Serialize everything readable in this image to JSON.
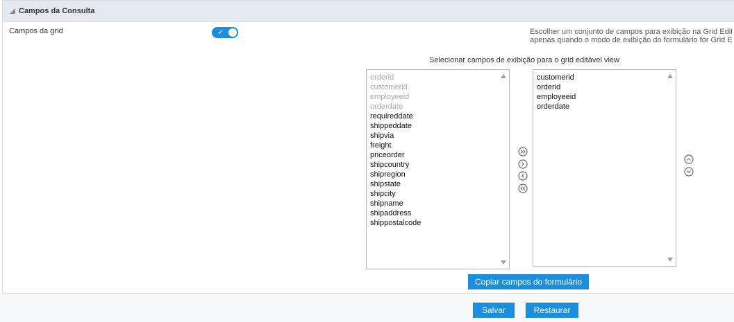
{
  "panel": {
    "title": "Campos da Consulta"
  },
  "field": {
    "label": "Campos da grid",
    "toggle_on": true,
    "help_line1": "Escolher um conjunto de campos para exibição na Grid Editá",
    "help_line2": "apenas quando o modo de exibição do formulário for Grid Ed"
  },
  "selector": {
    "title": "Selecionar campos de exibição para o grid editável view",
    "available": [
      {
        "label": "orderid",
        "disabled": true
      },
      {
        "label": "customerid",
        "disabled": true
      },
      {
        "label": "employeeid",
        "disabled": true
      },
      {
        "label": "orderdate",
        "disabled": true
      },
      {
        "label": "requireddate",
        "disabled": false
      },
      {
        "label": "shippeddate",
        "disabled": false
      },
      {
        "label": "shipvia",
        "disabled": false
      },
      {
        "label": "freight",
        "disabled": false
      },
      {
        "label": "priceorder",
        "disabled": false
      },
      {
        "label": "shipcountry",
        "disabled": false
      },
      {
        "label": "shipregion",
        "disabled": false
      },
      {
        "label": "shipstate",
        "disabled": false
      },
      {
        "label": "shipcity",
        "disabled": false
      },
      {
        "label": "shipname",
        "disabled": false
      },
      {
        "label": "shipaddress",
        "disabled": false
      },
      {
        "label": "shippostalcode",
        "disabled": false
      }
    ],
    "selected": [
      "customerid",
      "orderid",
      "employeeid",
      "orderdate"
    ]
  },
  "buttons": {
    "copy": "Copiar campos do formulário",
    "save": "Salvar",
    "restore": "Restaurar"
  },
  "colors": {
    "accent": "#1a8fdd",
    "header_bg": "#e4e9ef"
  },
  "icons": {
    "collapse": "triangle-collapse-icon",
    "move_all_right": "double-chevron-right-circle-icon",
    "move_right": "chevron-right-circle-icon",
    "move_left": "chevron-left-circle-icon",
    "move_all_left": "double-chevron-left-circle-icon",
    "move_up": "chevron-up-circle-icon",
    "move_down": "chevron-down-circle-icon"
  }
}
